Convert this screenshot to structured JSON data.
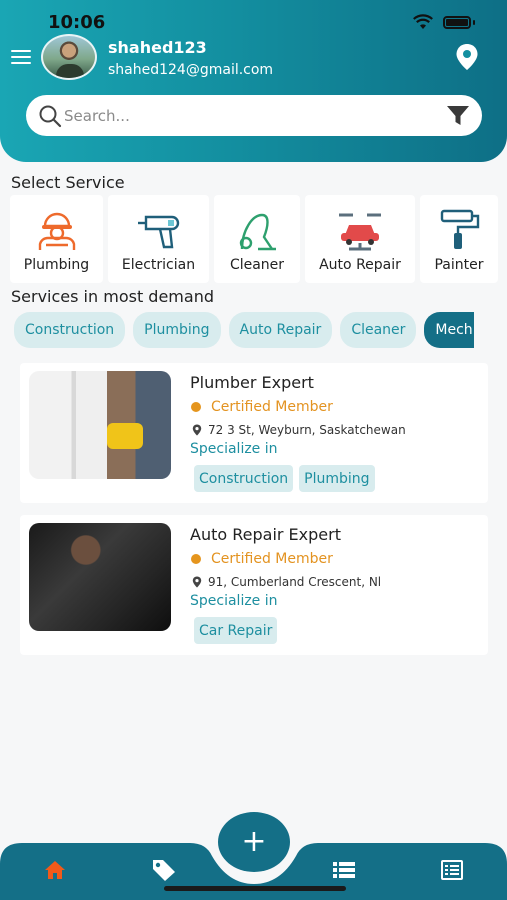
{
  "status_bar": {
    "time": "10:06"
  },
  "user": {
    "name": "shahed123",
    "email": "shahed124@gmail.com"
  },
  "search": {
    "placeholder": "Search..."
  },
  "select_service": {
    "title": "Select Service",
    "items": [
      {
        "label": "Plumbing",
        "icon": "plumber-icon"
      },
      {
        "label": "Electrician",
        "icon": "drill-icon"
      },
      {
        "label": "Cleaner",
        "icon": "vacuum-icon"
      },
      {
        "label": "Auto Repair",
        "icon": "car-repair-icon"
      },
      {
        "label": "Painter",
        "icon": "paint-roller-icon"
      }
    ]
  },
  "demand": {
    "title": "Services in most demand",
    "chips": [
      "Construction",
      "Plumbing",
      "Auto Repair",
      "Cleaner",
      "Mech"
    ]
  },
  "experts": [
    {
      "title": "Plumber Expert",
      "certified": "Certified Member",
      "address": "72 3 St, Weyburn, Saskatchewan",
      "specialize_label": "Specialize in",
      "tags": [
        "Construction",
        "Plumbing"
      ]
    },
    {
      "title": "Auto Repair Expert",
      "certified": "Certified Member",
      "address": "91, Cumberland Crescent, Nl",
      "specialize_label": "Specialize in",
      "tags": [
        "Car Repair"
      ]
    }
  ],
  "fab": {
    "label": "+"
  },
  "colors": {
    "header_start": "#1aa6b4",
    "header_end": "#0e6f86",
    "accent": "#146f87",
    "chip_bg": "#d8ecee",
    "chip_text": "#1e8fa0",
    "certified": "#e39321",
    "home_active": "#f05a1a"
  },
  "bottom_nav": [
    "home-icon",
    "tag-icon",
    "list-icon",
    "document-icon"
  ]
}
